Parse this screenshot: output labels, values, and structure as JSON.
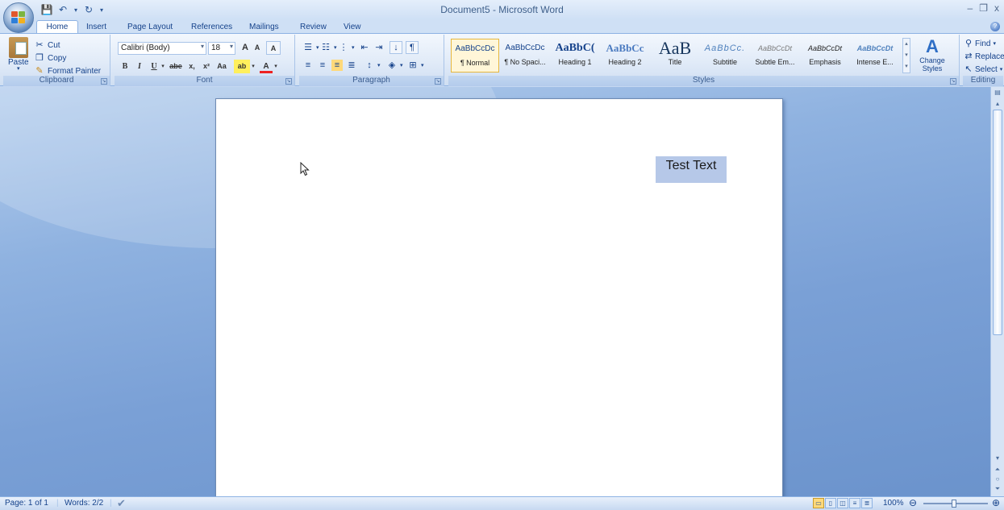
{
  "window": {
    "title": "Document5 - Microsoft Word",
    "controls": [
      "_",
      "▭",
      "x"
    ]
  },
  "quick_access": [
    "save-icon",
    "undo-icon",
    "redo-icon",
    "customize-icon"
  ],
  "tabs": [
    {
      "label": "Home",
      "active": true
    },
    {
      "label": "Insert"
    },
    {
      "label": "Page Layout"
    },
    {
      "label": "References"
    },
    {
      "label": "Mailings"
    },
    {
      "label": "Review"
    },
    {
      "label": "View"
    }
  ],
  "clipboard": {
    "label": "Clipboard",
    "paste": "Paste",
    "cut": "Cut",
    "copy": "Copy",
    "format_painter": "Format Painter"
  },
  "font": {
    "label": "Font",
    "family": "Calibri (Body)",
    "size": "18",
    "bold": "B",
    "italic": "I",
    "underline": "U",
    "strike": "abe",
    "subscript": "x,",
    "superscript": "x²",
    "change_case": "Aa",
    "grow": "A",
    "shrink": "A",
    "clear": "A",
    "highlight": "ab",
    "color": "A"
  },
  "paragraph": {
    "label": "Paragraph"
  },
  "styles": {
    "label": "Styles",
    "items": [
      {
        "preview": "AaBbCcDc",
        "name": "¶ Normal",
        "selected": true
      },
      {
        "preview": "AaBbCcDc",
        "name": "¶ No Spaci..."
      },
      {
        "preview": "AaBbC(",
        "name": "Heading 1"
      },
      {
        "preview": "AaBbCc",
        "name": "Heading 2"
      },
      {
        "preview": "AaB",
        "name": "Title"
      },
      {
        "preview": "AaBbCc.",
        "name": "Subtitle"
      },
      {
        "preview": "AaBbCcDt",
        "name": "Subtle Em..."
      },
      {
        "preview": "AaBbCcDt",
        "name": "Emphasis"
      },
      {
        "preview": "AaBbCcDt",
        "name": "Intense E..."
      }
    ],
    "change_styles": "Change Styles"
  },
  "editing": {
    "label": "Editing",
    "find": "Find",
    "replace": "Replace",
    "select": "Select"
  },
  "document": {
    "selected_text": "Test Text"
  },
  "status": {
    "page": "Page: 1 of 1",
    "words": "Words: 2/2",
    "zoom": "100%"
  }
}
